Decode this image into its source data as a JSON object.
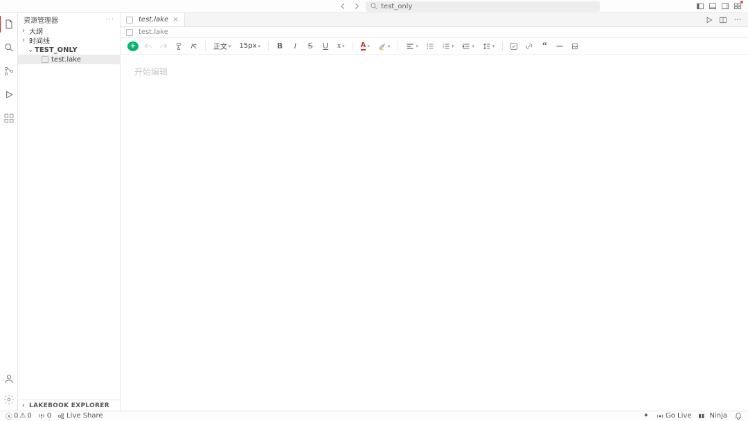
{
  "titlebar": {
    "search_text": "test_only"
  },
  "sidebar": {
    "title": "资源管理器",
    "sections": [
      "大纲",
      "时间线",
      "TEST_ONLY"
    ],
    "file": "test.lake",
    "footer": "LAKEBOOK EXPLORER"
  },
  "tabs": {
    "active": "test.lake"
  },
  "breadcrumb": {
    "file": "test.lake"
  },
  "toolbar": {
    "paragraph_style": "正文",
    "font_size": "15px"
  },
  "editor": {
    "placeholder": "开始编辑"
  },
  "statusbar": {
    "errors": "0",
    "warnings": "0",
    "ports": "0",
    "live_share": "Live Share",
    "go_live": "Go Live",
    "ninja": "Ninja"
  }
}
